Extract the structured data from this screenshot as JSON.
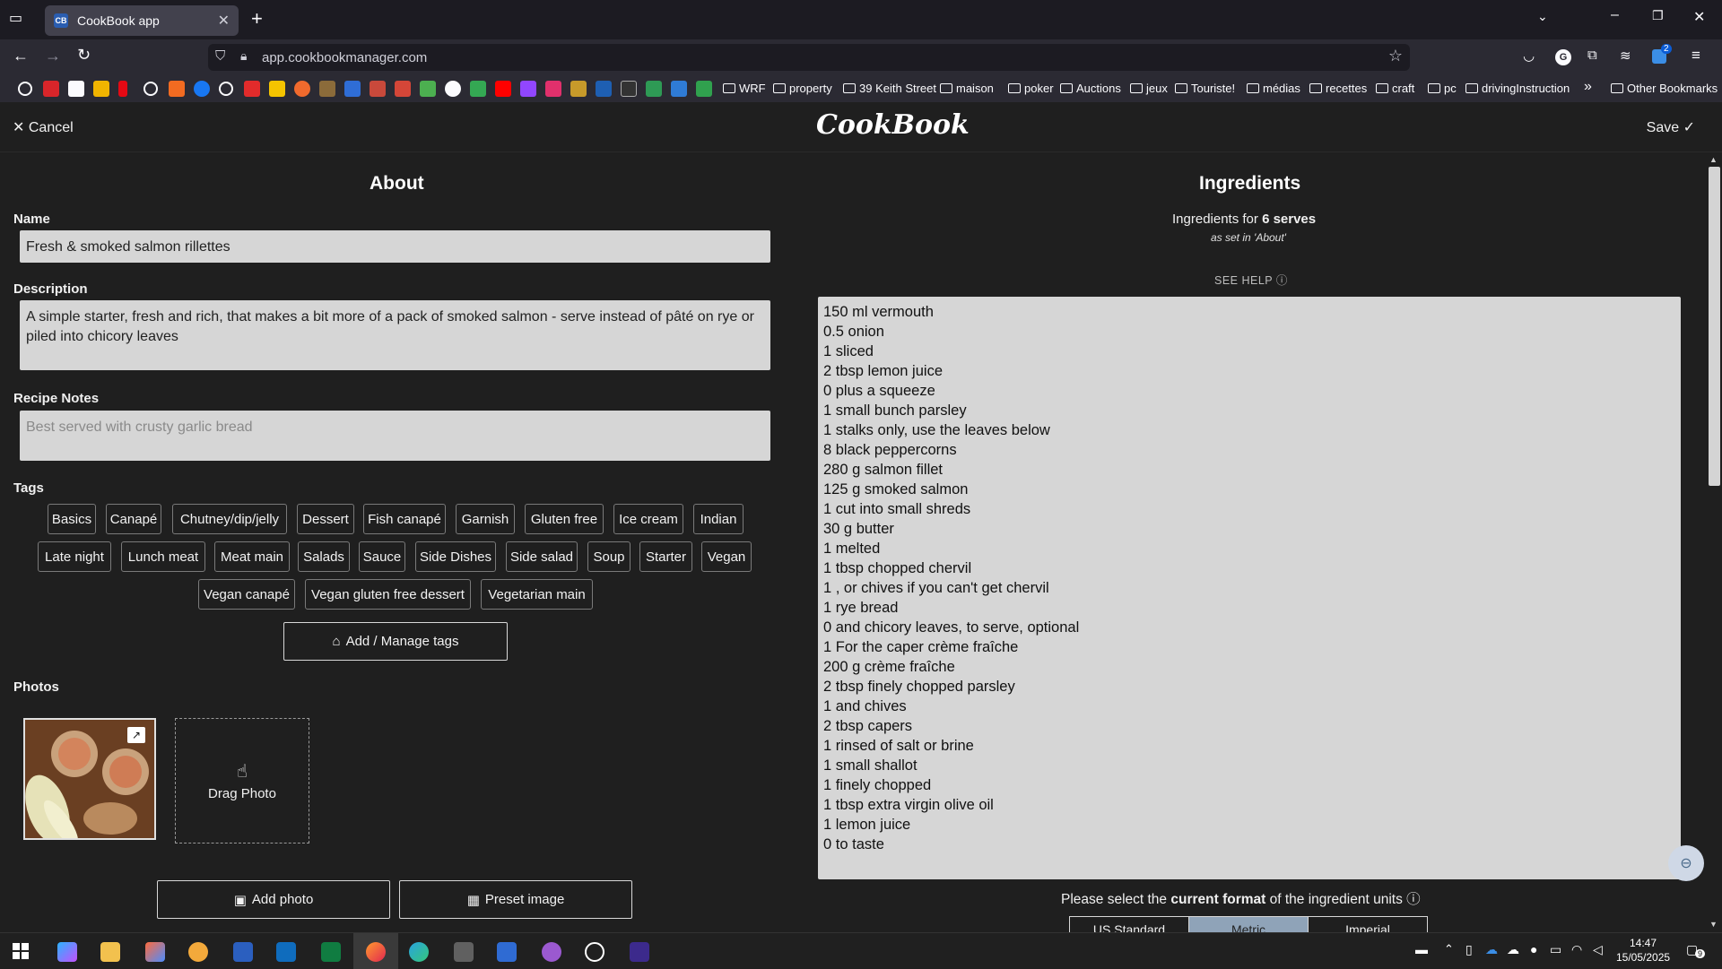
{
  "browser": {
    "tab_title": "CookBook app",
    "tab_favicon_text": "CB",
    "url": "app.cookbookmanager.com",
    "bookmarks": [
      {
        "label": "WRF"
      },
      {
        "label": "property"
      },
      {
        "label": "39 Keith Street"
      },
      {
        "label": "maison"
      },
      {
        "label": "poker"
      },
      {
        "label": "Auctions"
      },
      {
        "label": "jeux"
      },
      {
        "label": "Touriste!"
      },
      {
        "label": "médias"
      },
      {
        "label": "recettes"
      },
      {
        "label": "craft"
      },
      {
        "label": "pc"
      },
      {
        "label": "drivingInstruction"
      },
      {
        "label": "Other Bookmarks"
      }
    ],
    "extension_badge": "2"
  },
  "header": {
    "cancel_label": "Cancel",
    "logo": "CookBook",
    "save_label": "Save"
  },
  "about": {
    "title": "About",
    "name_label": "Name",
    "name_value": "Fresh & smoked salmon rillettes",
    "description_label": "Description",
    "description_value": "A simple starter, fresh and rich, that makes a bit more of a pack of smoked salmon - serve instead of pâté on rye or piled into chicory leaves",
    "notes_label": "Recipe Notes",
    "notes_placeholder": "Best served with crusty garlic bread",
    "tags_label": "Tags",
    "tags": [
      "Basics",
      "Canapé",
      "Chutney/dip/jelly",
      "Dessert",
      "Fish canapé",
      "Garnish",
      "Gluten free",
      "Ice cream",
      "Indian",
      "Late night",
      "Lunch meat",
      "Meat main",
      "Salads",
      "Sauce",
      "Side Dishes",
      "Side salad",
      "Soup",
      "Starter",
      "Vegan",
      "Vegan canapé",
      "Vegan gluten free dessert",
      "Vegetarian main"
    ],
    "manage_tags_label": "Add / Manage tags",
    "photos_label": "Photos",
    "drag_photo_label": "Drag Photo",
    "add_photo_label": "Add photo",
    "preset_image_label": "Preset image"
  },
  "ingredients": {
    "title": "Ingredients",
    "serves_prefix": "Ingredients for ",
    "serves_value": "6 serves",
    "serves_note": "as set in 'About'",
    "help_label": "SEE HELP",
    "lines": [
      "150 ml vermouth",
      "0.5 onion",
      "1 sliced",
      "2 tbsp lemon juice",
      "0 plus a squeeze",
      "1 small bunch parsley",
      "1 stalks only, use the leaves below",
      "8 black peppercorns",
      "280 g salmon fillet",
      "125 g smoked salmon",
      "1 cut into small shreds",
      "30 g butter",
      "1 melted",
      "1 tbsp chopped chervil",
      "1 , or chives if you can't get chervil",
      "1 rye bread",
      "0 and chicory leaves, to serve, optional",
      "1 For the caper crème fraîche",
      "200 g crème fraîche",
      "2 tbsp finely chopped parsley",
      "1 and chives",
      "2 tbsp capers",
      "1 rinsed of salt or brine",
      "1 small shallot",
      "1 finely chopped",
      "1 tbsp extra virgin olive oil",
      "1 lemon juice",
      "0 to taste"
    ],
    "format_prefix": "Please select the ",
    "format_bold": "current format",
    "format_suffix": " of the ingredient units",
    "formats": [
      "US Standard",
      "Metric",
      "Imperial"
    ],
    "selected_format": "Metric"
  },
  "taskbar": {
    "time": "14:47",
    "date": "15/05/2025",
    "notification_count": "9"
  },
  "colors": {
    "background": "#1f1f1f",
    "field_bg": "#d6d6d6",
    "selected_format": "#8fa3b8"
  }
}
